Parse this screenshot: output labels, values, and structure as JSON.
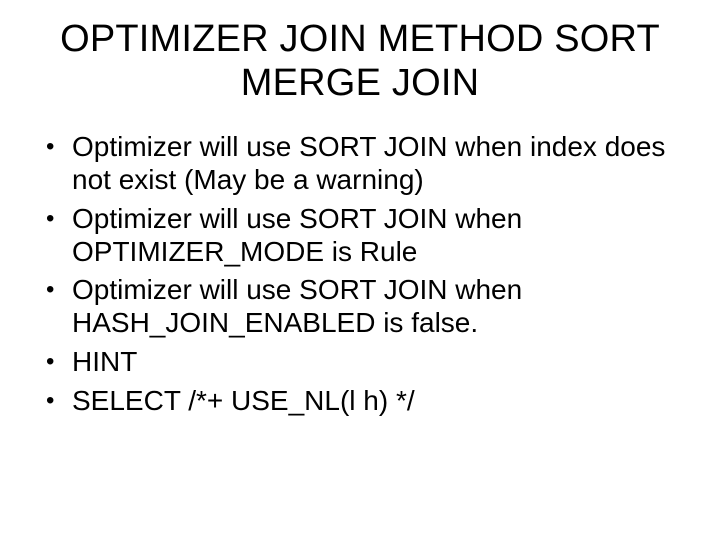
{
  "slide": {
    "title": "OPTIMIZER JOIN METHOD SORT MERGE JOIN",
    "bullets": [
      "Optimizer will use SORT JOIN when index does not exist (May be a warning)",
      "Optimizer will use SORT JOIN when OPTIMIZER_MODE is Rule",
      "Optimizer will use SORT JOIN when HASH_JOIN_ENABLED is false.",
      "HINT",
      "SELECT /*+ USE_NL(l h) */"
    ]
  }
}
